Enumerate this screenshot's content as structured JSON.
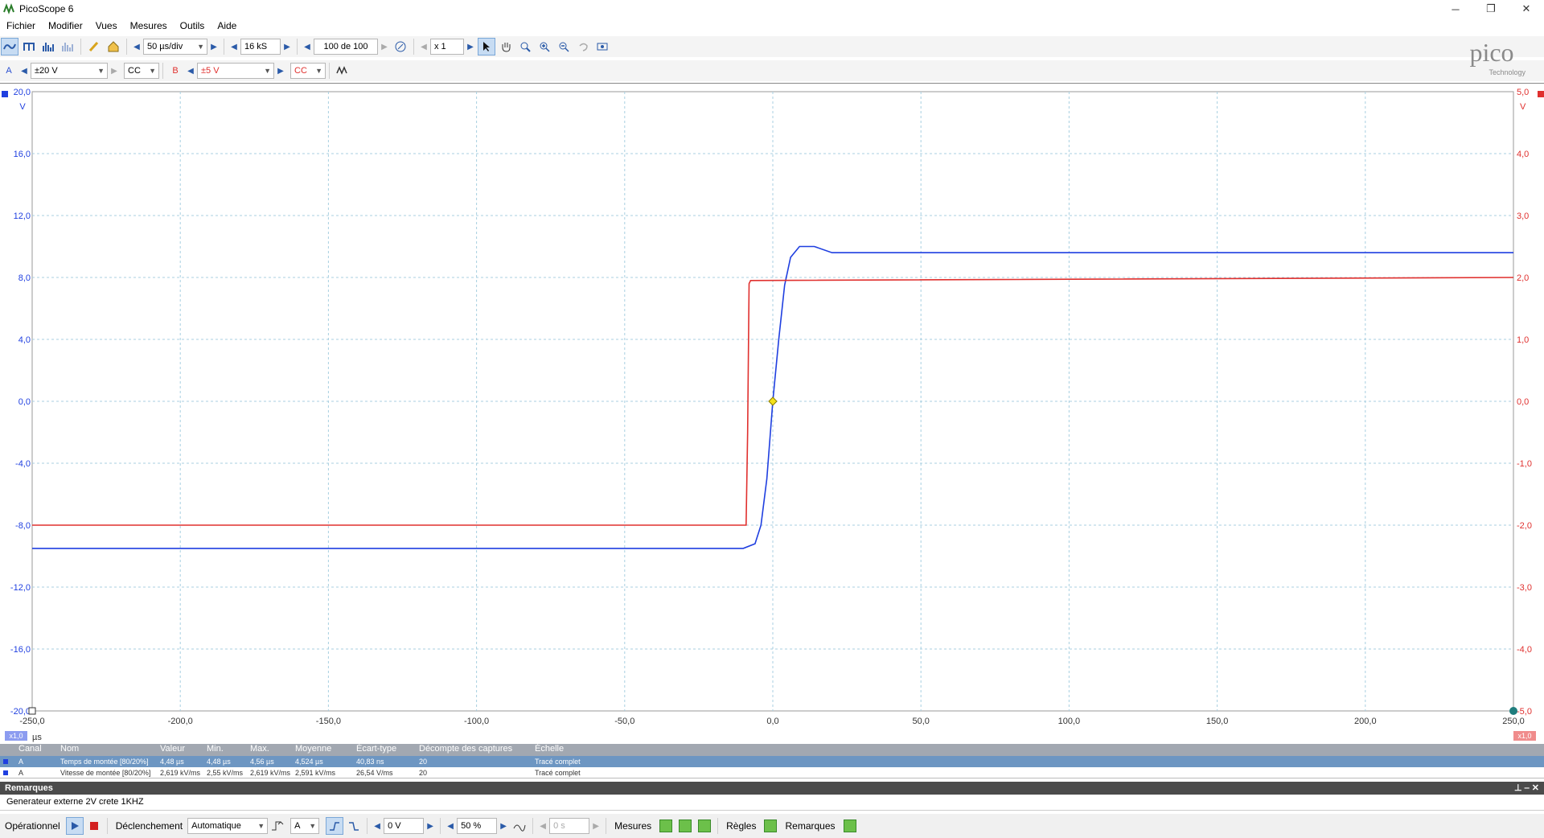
{
  "window": {
    "title": "PicoScope 6",
    "minimize": "─",
    "restore": "❐",
    "close": "✕"
  },
  "menu": [
    "Fichier",
    "Modifier",
    "Vues",
    "Mesures",
    "Outils",
    "Aide"
  ],
  "toolbar": {
    "timebase": "50 µs/div",
    "samples": "16 kS",
    "captures": "100 de 100",
    "zoom": "x 1"
  },
  "channels": {
    "a": {
      "label": "A",
      "range": "±20 V",
      "coupling": "CC",
      "color": "#2a4fd1"
    },
    "b": {
      "label": "B",
      "range": "±5 V",
      "coupling": "CC",
      "color": "#e0302e"
    }
  },
  "logo": {
    "text": "pico",
    "sub": "Technology"
  },
  "chart_data": {
    "type": "line",
    "xlabel": "µs",
    "x_ticks": [
      "-250,0",
      "-200,0",
      "-150,0",
      "-100,0",
      "-50,0",
      "0,0",
      "50,0",
      "100,0",
      "150,0",
      "200,0",
      "250,0"
    ],
    "y_left_ticks": [
      "20,0",
      "16,0",
      "12,0",
      "8,0",
      "4,0",
      "0,0",
      "-4,0",
      "-8,0",
      "-12,0",
      "-16,0",
      "-20,0"
    ],
    "y_left_unit": "V",
    "y_right_ticks": [
      "5,0",
      "4,0",
      "3,0",
      "2,0",
      "1,0",
      "0,0",
      "-1,0",
      "-2,0",
      "-3,0",
      "-4,0",
      "-5,0"
    ],
    "y_right_unit": "V",
    "xlim": [
      -250,
      250
    ],
    "ylim_left": [
      -20,
      20
    ],
    "ylim_right": [
      -5,
      5
    ],
    "grid": true,
    "x_scale_badge": "x1,0",
    "series": [
      {
        "name": "A",
        "axis": "left",
        "color": "#1f3fe0",
        "x": [
          -250,
          -10,
          -6,
          -4,
          -2,
          0,
          2,
          4,
          6,
          9,
          14,
          20,
          250
        ],
        "y": [
          -9.5,
          -9.5,
          -9.2,
          -8.0,
          -5.0,
          0.0,
          4.0,
          7.5,
          9.3,
          10.0,
          10.0,
          9.6,
          9.6
        ]
      },
      {
        "name": "B",
        "axis": "right",
        "color": "#e0302e",
        "x": [
          -250,
          -9,
          -8.5,
          -8,
          -7.5,
          250
        ],
        "y": [
          -2.0,
          -2.0,
          -0.5,
          1.9,
          1.95,
          2.0
        ]
      }
    ],
    "trigger_marker": {
      "x": 0,
      "y": 0
    }
  },
  "measurements": {
    "headers": [
      "Canal",
      "Nom",
      "Valeur",
      "Min.",
      "Max.",
      "Moyenne",
      "Écart-type",
      "Décompte des captures",
      "Échelle"
    ],
    "rows": [
      [
        "A",
        "Temps de montée  [80/20%]",
        "4,48 µs",
        "4,48 µs",
        "4,56 µs",
        "4,524 µs",
        "40,83 ns",
        "20",
        "Tracé complet"
      ],
      [
        "A",
        "Vitesse de montée  [80/20%]",
        "2,619 kV/ms",
        "2,55 kV/ms",
        "2,619 kV/ms",
        "2,591 kV/ms",
        "26,54 V/ms",
        "20",
        "Tracé complet"
      ]
    ]
  },
  "remarks": {
    "title": "Remarques",
    "text": "Generateur externe 2V crete 1KHZ"
  },
  "status": {
    "run_label": "Opérationnel",
    "trigger_label": "Déclenchement",
    "trigger_mode": "Automatique",
    "trigger_source": "A",
    "trigger_level": "0 V",
    "pretrigger": "50 %",
    "delay": "0 s",
    "measures_label": "Mesures",
    "rulers_label": "Règles",
    "notes_label": "Remarques"
  }
}
